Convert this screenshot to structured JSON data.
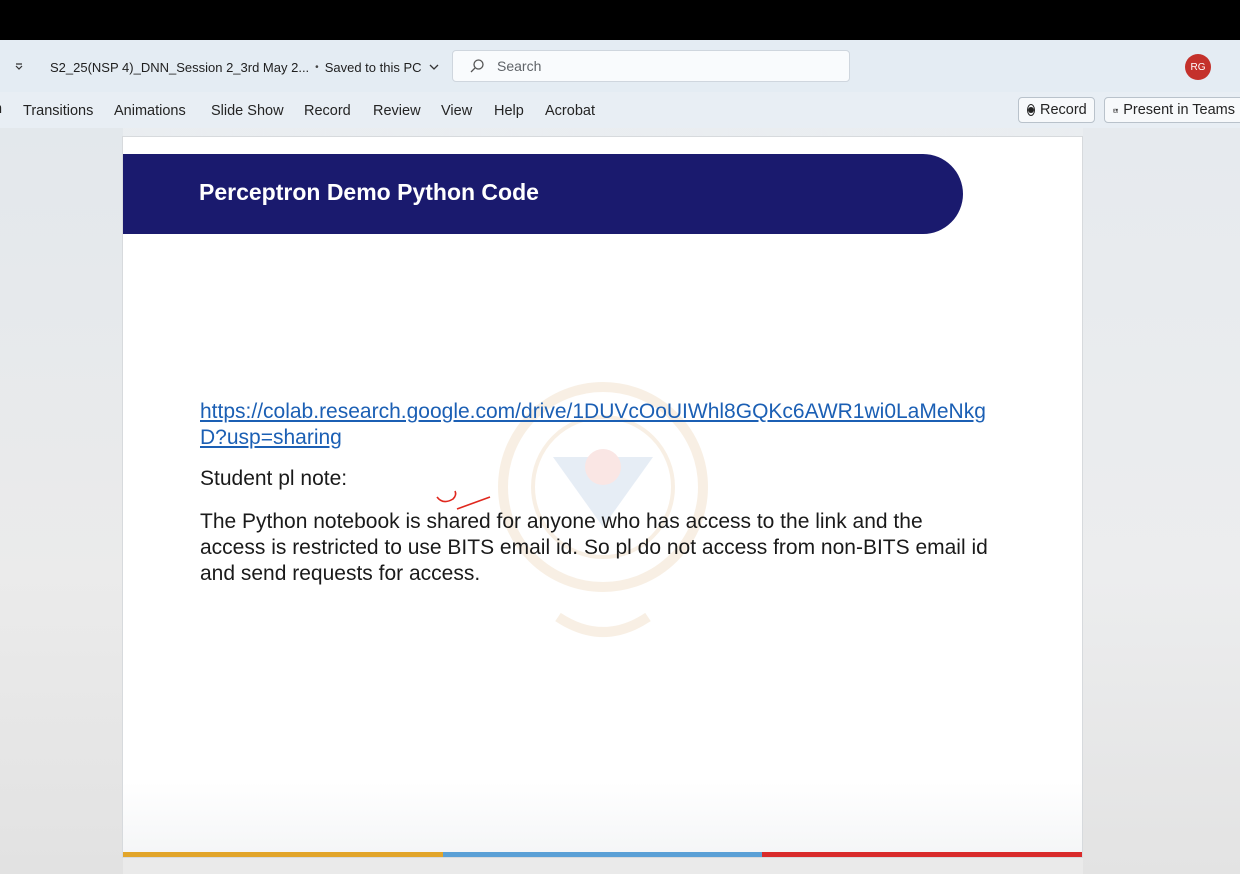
{
  "window": {
    "doc_title": "S2_25(NSP 4)_DNN_Session 2_3rd May 2...",
    "separator": "•",
    "save_status": "Saved to this PC",
    "search_placeholder": "Search",
    "avatar_initials": "RG"
  },
  "ribbon": {
    "partial_tab": "n",
    "tabs": [
      "Transitions",
      "Animations",
      "Slide Show",
      "Record",
      "Review",
      "View",
      "Help",
      "Acrobat"
    ],
    "record_button": "Record",
    "present_button": "Present in Teams"
  },
  "slide": {
    "title": "Perceptron Demo Python Code",
    "link": "https://colab.research.google.com/drive/1DUVcOoUIWhl8GQKc6AWR1wi0LaMeNkgD?usp=sharing",
    "note_heading": "Student pl note:",
    "note_body": "The Python notebook is shared for anyone who has access to the link and the access is restricted to use BITS email id. So pl do not access from non-BITS email id and send requests for access.",
    "colors": {
      "banner": "#1a1a6e",
      "link": "#1b5fb4",
      "footer": [
        "#e2a52a",
        "#5aa0d6",
        "#d92b2b"
      ],
      "annotation": "#e0281e"
    }
  }
}
